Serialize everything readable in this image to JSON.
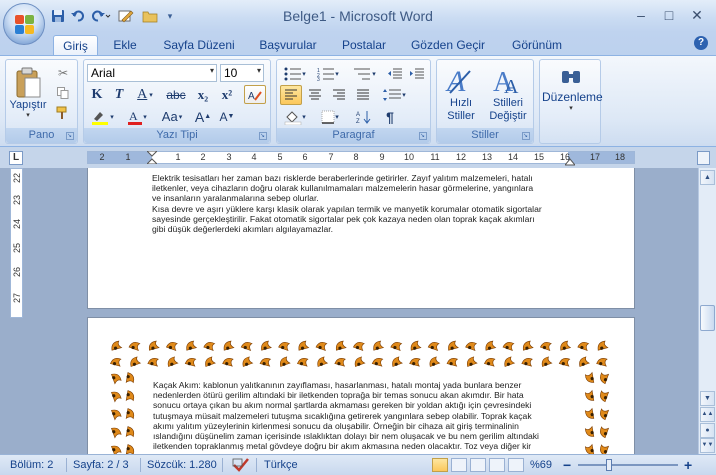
{
  "window": {
    "title": "Belge1 - Microsoft Word",
    "controls": {
      "minimize": "–",
      "maximize": "□",
      "close": "✕"
    }
  },
  "quick_access": [
    {
      "name": "save-icon",
      "glyph": "💾"
    },
    {
      "name": "undo-icon",
      "glyph": "↺"
    },
    {
      "name": "redo-icon",
      "glyph": "↷"
    },
    {
      "name": "draw-table-icon",
      "glyph": "✎"
    },
    {
      "name": "open-folder-icon",
      "glyph": "📂"
    },
    {
      "name": "customize-qat-icon",
      "glyph": "▾"
    }
  ],
  "tabs": [
    {
      "label": "Giriş",
      "active": true
    },
    {
      "label": "Ekle"
    },
    {
      "label": "Sayfa Düzeni"
    },
    {
      "label": "Başvurular"
    },
    {
      "label": "Postalar"
    },
    {
      "label": "Gözden Geçir"
    },
    {
      "label": "Görünüm"
    }
  ],
  "ribbon": {
    "clipboard": {
      "label": "Pano",
      "paste": "Yapıştır"
    },
    "font": {
      "label": "Yazı Tipi",
      "font_name": "Arial",
      "font_size": "10",
      "bold": "K",
      "italic": "T",
      "underline": "A",
      "strike": "abc",
      "subscript": "x₂",
      "superscript": "x²",
      "clear": "Aa",
      "grow": "A",
      "shrink": "A"
    },
    "paragraph": {
      "label": "Paragraf"
    },
    "styles": {
      "label": "Stiller",
      "quick": "Hızlı Stiller",
      "change": "Stilleri Değiştir"
    },
    "editing": {
      "label": "Düzenleme"
    }
  },
  "ruler": {
    "h_numbers": [
      "2",
      "1",
      "1",
      "2",
      "3",
      "4",
      "5",
      "6",
      "7",
      "8",
      "9",
      "10",
      "11",
      "12",
      "13",
      "14",
      "15",
      "16",
      "17",
      "18"
    ],
    "v_numbers": [
      "22",
      "23",
      "24",
      "25",
      "26",
      "27"
    ]
  },
  "document": {
    "page1_lines": [
      "Elektrik tesisatları her zaman bazı  risklerde beraberlerinde  getirirler. Zayıf yalıtım malzemeleri, hatalı",
      "iletkenler, veya cihazların doğru olarak kullanılmamaları malzemelerin hasar görmelerine, yangınlara",
      "ve insanların yaralanmalarına  sebep olurlar.",
      "Kısa devre ve aşırı yüklere karşı klasik olarak yapılan termik ve manyetik korumalar otomatik sigortalar",
      "sayesinde gerçekleştirilir. Fakat otomatik sigortalar pek çok kazaya neden olan toprak kaçak akımları",
      "gibi düşük değerlerdeki akımları algılayamazlar."
    ],
    "page2_lines": [
      "Kaçak Akım: kablonun yalıtkanının zayıflaması, hasarlanması,  hatalı montaj yada bunlara benzer",
      "nedenlerden ötürü gerilim altındaki bir iletkenden toprağa bir temas sonucu akan akımdır. Bir hata",
      "sonucu ortaya çıkan bu akım normal şartlarda akmaması gereken bir yoldan aktığı için çevresindeki",
      "tutuşmaya müsait malzemeleri tutuşma sıcaklığına getirerek yangınlara sebep olabilir. Toprak kaçak",
      "akımı yalıtım yüzeylerinin kirlenmesi sonucu da oluşabilir. Örneğin bir cihaza ait giriş terminalinin",
      "ıslandığını düşünelim zaman içerisinde ıslaklıktan dolayı bir nem oluşacak ve bu nem gerilim altındaki",
      "iletkenden topraklanmış metal gövdeye doğru bir akım akmasına neden olacaktır. Toz veya diğer kir"
    ]
  },
  "status": {
    "section": "Bölüm: 2",
    "page": "Sayfa: 2 / 3",
    "words": "Sözcük: 1.280",
    "language": "Türkçe",
    "zoom": "%69",
    "zoom_minus": "−",
    "zoom_plus": "+"
  },
  "colors": {
    "accent": "#15428b",
    "ribbon_bg": "#dde8f6",
    "selected": "#fcc85b",
    "doc_bg": "#9aaecb",
    "border_art": "#e08a1a"
  }
}
